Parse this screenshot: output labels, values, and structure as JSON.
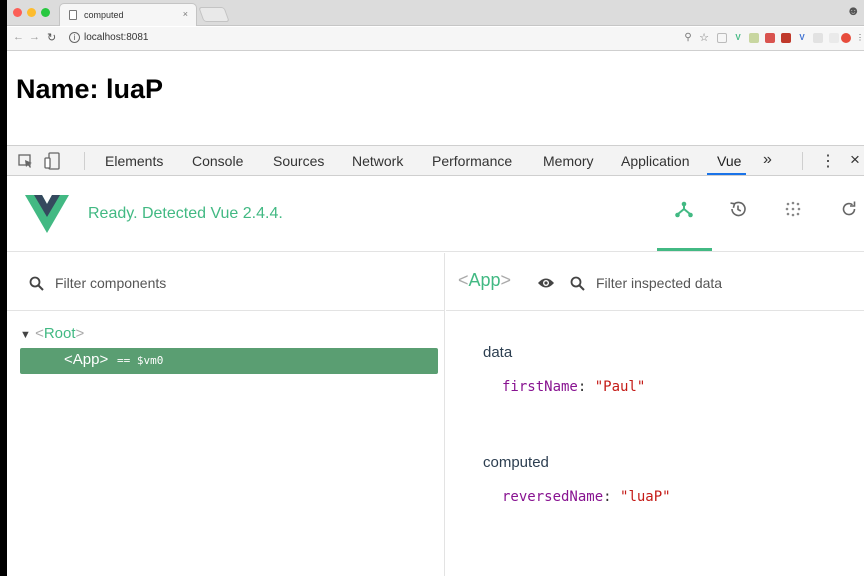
{
  "browser": {
    "tab_title": "computed",
    "tab_close": "×",
    "url": "localhost:8081",
    "profile_icon": "person-circle-icon"
  },
  "page": {
    "heading": "Name: luaP"
  },
  "devtools": {
    "tabs": [
      "Elements",
      "Console",
      "Sources",
      "Network",
      "Performance",
      "Memory",
      "Application",
      "Vue"
    ],
    "active_tab": "Vue",
    "overflow_label": "»",
    "menu_label": "⋮",
    "close_label": "×"
  },
  "vue": {
    "status": "Ready. Detected Vue 2.4.4.",
    "accent_color": "#42b983",
    "header_icons": [
      "components-icon",
      "history-icon",
      "vuex-icon",
      "refresh-icon"
    ],
    "filter_components_placeholder": "Filter components",
    "filter_inspected_placeholder": "Filter inspected data",
    "tree": {
      "root_open": "<",
      "root_name": "Root",
      "root_close": ">",
      "app_label": "<App>",
      "app_vm": "== $vm0"
    },
    "inspected": {
      "open": "<",
      "name": "App",
      "close": ">",
      "sections": [
        {
          "title": "data",
          "key": "firstName",
          "value": "\"Paul\""
        },
        {
          "title": "computed",
          "key": "reversedName",
          "value": "\"luaP\""
        }
      ]
    }
  }
}
